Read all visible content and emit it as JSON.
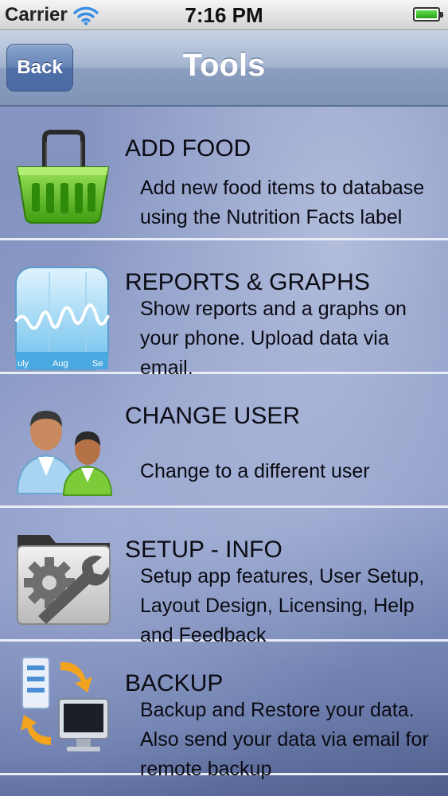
{
  "status_bar": {
    "carrier": "Carrier",
    "time": "7:16 PM",
    "wifi_icon": "wifi-icon",
    "battery_icon": "battery-icon"
  },
  "nav_bar": {
    "back_label": "Back",
    "title": "Tools"
  },
  "items": [
    {
      "title": "ADD FOOD",
      "icon": "shopping-basket-icon",
      "description_lines": [
        "Add new food items to database",
        "using the Nutrition Facts label"
      ]
    },
    {
      "title": "REPORTS & GRAPHS",
      "icon": "graph-icon",
      "icon_labels": [
        "uly",
        "Aug",
        "Se"
      ],
      "description_lines": [
        "Show reports and a graphs on",
        "your phone. Upload data via",
        "email."
      ]
    },
    {
      "title": "CHANGE USER",
      "icon": "users-icon",
      "description_lines": [
        "Change to a different user"
      ]
    },
    {
      "title": "SETUP - INFO",
      "icon": "settings-folder-icon",
      "description_lines": [
        "Setup app features, User Setup,",
        "Layout Design, Licensing, Help",
        "and Feedback"
      ]
    },
    {
      "title": "BACKUP",
      "icon": "backup-sync-icon",
      "description_lines": [
        "Backup and Restore your data.",
        "Also send your data via email for",
        "remote backup"
      ]
    }
  ],
  "colors": {
    "nav_gradient_top": "#c9d3e4",
    "nav_gradient_bottom": "#7f95b8",
    "back_button": "#4d6ea6",
    "content_background": "#8795c2",
    "separator": "#e9edf6",
    "basket_green": "#5fc41f"
  }
}
